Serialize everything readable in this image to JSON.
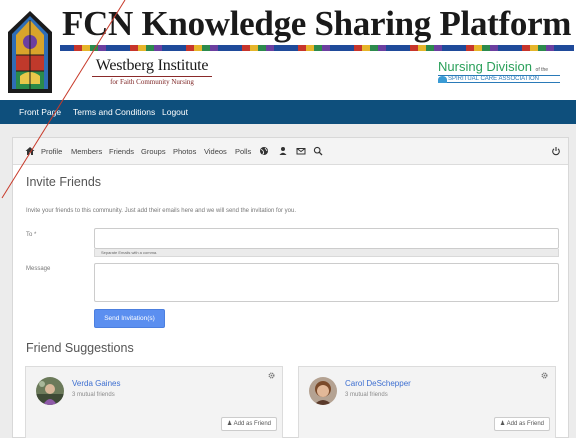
{
  "header": {
    "title": "FCN Knowledge Sharing Platform",
    "westberg_name": "Westberg Institute",
    "westberg_sub": "for Faith Community Nursing",
    "nursing_division": "Nursing Division",
    "nursing_of_the": "of the",
    "nursing_assoc": "SPIRITUAL CARE ASSOCIATION"
  },
  "topnav": {
    "items": [
      {
        "label": "Front Page"
      },
      {
        "label": "Terms and Conditions"
      },
      {
        "label": "Logout"
      }
    ]
  },
  "toolbar": {
    "items": [
      {
        "label": "Profile"
      },
      {
        "label": "Members"
      },
      {
        "label": "Friends"
      },
      {
        "label": "Groups"
      },
      {
        "label": "Photos"
      },
      {
        "label": "Videos"
      },
      {
        "label": "Polls"
      }
    ],
    "icons": [
      "home-icon",
      "globe-icon",
      "user-icon",
      "mail-icon",
      "search-icon",
      "power-icon"
    ]
  },
  "invite": {
    "heading": "Invite Friends",
    "intro": "Invite your friends to this community. Just add their emails here and we will send the invitation for you.",
    "to_label": "To *",
    "to_help": "Separate Emails with a comma.",
    "message_label": "Message",
    "send_label": "Send Invitation(s)"
  },
  "suggestions": {
    "heading": "Friend Suggestions",
    "friends": [
      {
        "name": "Verda Gaines",
        "mutual": "3 mutual friends",
        "add_label": "Add as Friend"
      },
      {
        "name": "Carol DeSchepper",
        "mutual": "3 mutual friends",
        "add_label": "Add as Friend"
      }
    ]
  },
  "colors": {
    "nav_bg": "#0e4f7c",
    "link": "#3d6fd1",
    "button": "#5b8ff0",
    "nursing_green": "#2aa05a"
  }
}
